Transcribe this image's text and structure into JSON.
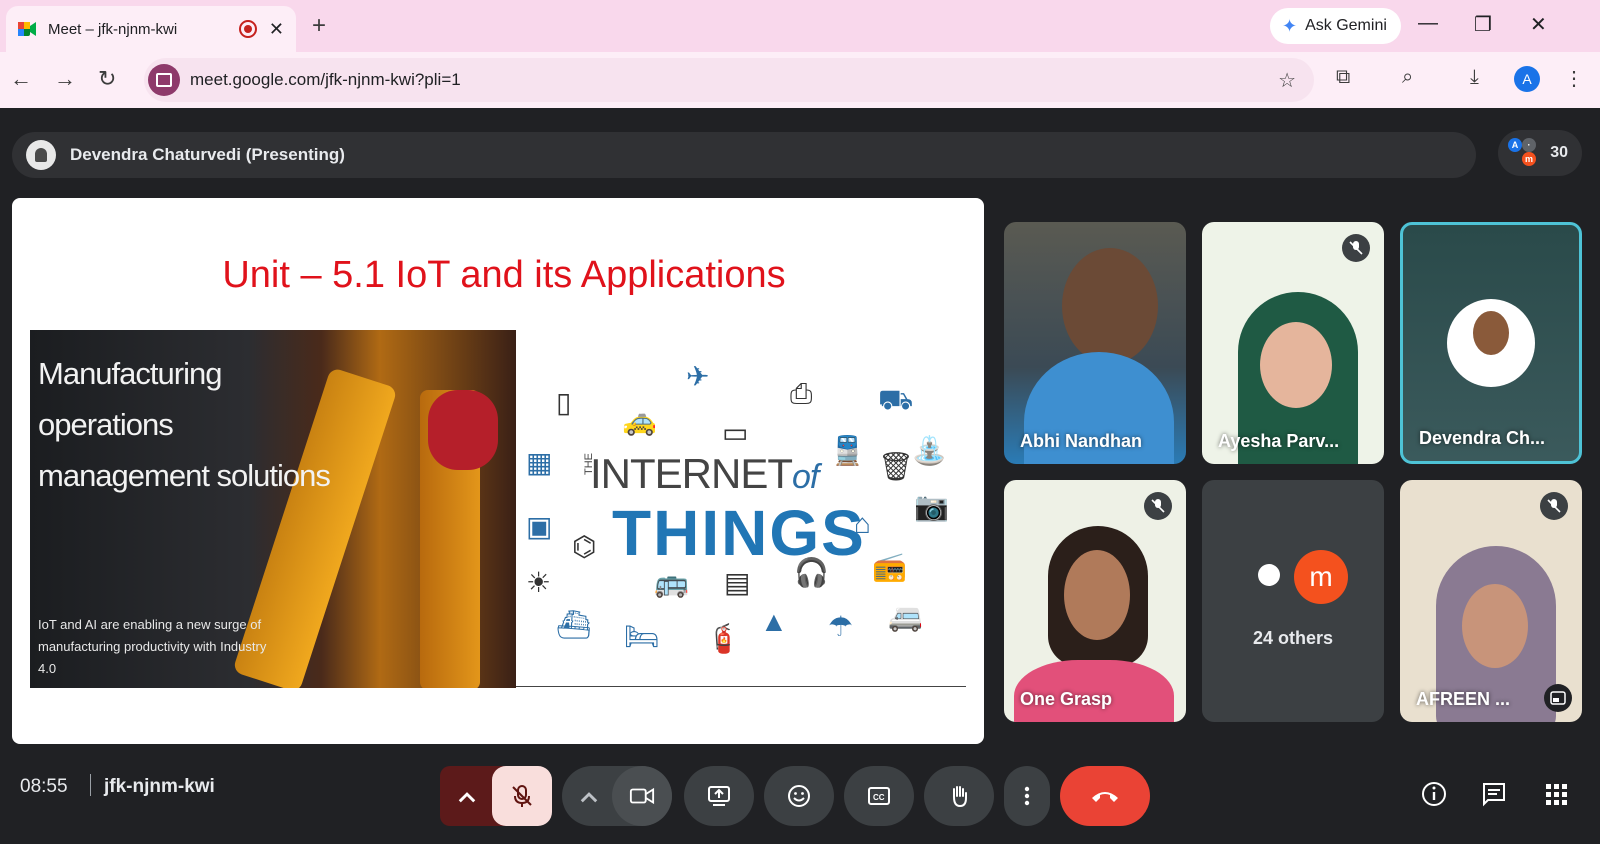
{
  "browser": {
    "tab_title": "Meet – jfk-njnm-kwi",
    "new_tab_label": "+",
    "gemini_label": "Ask Gemini",
    "url": "meet.google.com/jfk-njnm-kwi?pli=1",
    "profile_initial": "A"
  },
  "meet": {
    "presenter_banner": "Devendra Chaturvedi (Presenting)",
    "participant_count": "30",
    "slide": {
      "title": "Unit – 5.1 IoT and its Applications",
      "heading_lines": [
        "Manufacturing",
        "operations",
        "management solutions"
      ],
      "subtext_lines": [
        "IoT and AI are enabling a new surge of",
        "manufacturing productivity with Industry",
        "4.0"
      ],
      "graphic_line1_the": "THE",
      "graphic_line1": "INTERNET",
      "graphic_of": "of",
      "graphic_line2": "THINGS"
    },
    "tiles": [
      {
        "name": "Abhi Nandhan",
        "muted": false
      },
      {
        "name": "Ayesha Parv...",
        "muted": true
      },
      {
        "name": "Devendra Ch...",
        "muted": false,
        "speaking": true
      },
      {
        "name": "One Grasp",
        "muted": true
      },
      {
        "name": "24 others",
        "avatar_letter": "m"
      },
      {
        "name": "AFREEN ...",
        "muted": true
      }
    ],
    "time": "08:55",
    "meeting_code": "jfk-njnm-kwi"
  },
  "colors": {
    "title_red": "#e0121b",
    "things_blue": "#2176b5",
    "end_call": "#ea4335",
    "speaking_border": "#4ec3d6"
  }
}
